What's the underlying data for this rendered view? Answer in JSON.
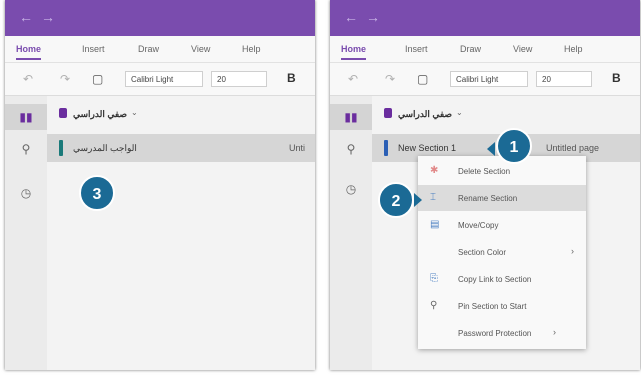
{
  "app": {
    "tabs": [
      "Home",
      "Insert",
      "Draw",
      "View",
      "Help"
    ],
    "font_name": "Calibri Light",
    "font_size": "20",
    "bold_label": "B"
  },
  "icons": {
    "back": "back-arrow-icon",
    "forward": "forward-arrow-icon",
    "undo": "undo-icon",
    "redo": "redo-icon",
    "clipboard": "clipboard-icon",
    "notebooks": "notebooks-icon",
    "search": "search-icon",
    "recent": "clock-icon"
  },
  "left_panel": {
    "notebook_name": "صفي الدراسي",
    "section_name": "الواجب المدرسي",
    "page_name": "Unti",
    "badge": "3"
  },
  "right_panel": {
    "notebook_name": "صفي الدراسي",
    "section_name": "New Section 1",
    "page_name": "Untitled page",
    "badge_1": "1",
    "badge_2": "2",
    "context_menu": [
      {
        "label": "Delete Section",
        "icon": "delete-icon"
      },
      {
        "label": "Rename Section",
        "icon": "rename-icon"
      },
      {
        "label": "Move/Copy",
        "icon": "move-copy-icon"
      },
      {
        "label": "Section Color",
        "icon": "",
        "submenu": "›"
      },
      {
        "label": "Copy Link to Section",
        "icon": "copy-link-icon"
      },
      {
        "label": "Pin Section to Start",
        "icon": "pin-icon"
      },
      {
        "label": "Password Protection",
        "icon": "",
        "submenu": "›"
      }
    ]
  },
  "colors": {
    "titlebar": "#7a4cae",
    "accent": "#7a4cae",
    "badge": "#1b6a95",
    "notebook_icon": "#6a2d9e"
  }
}
